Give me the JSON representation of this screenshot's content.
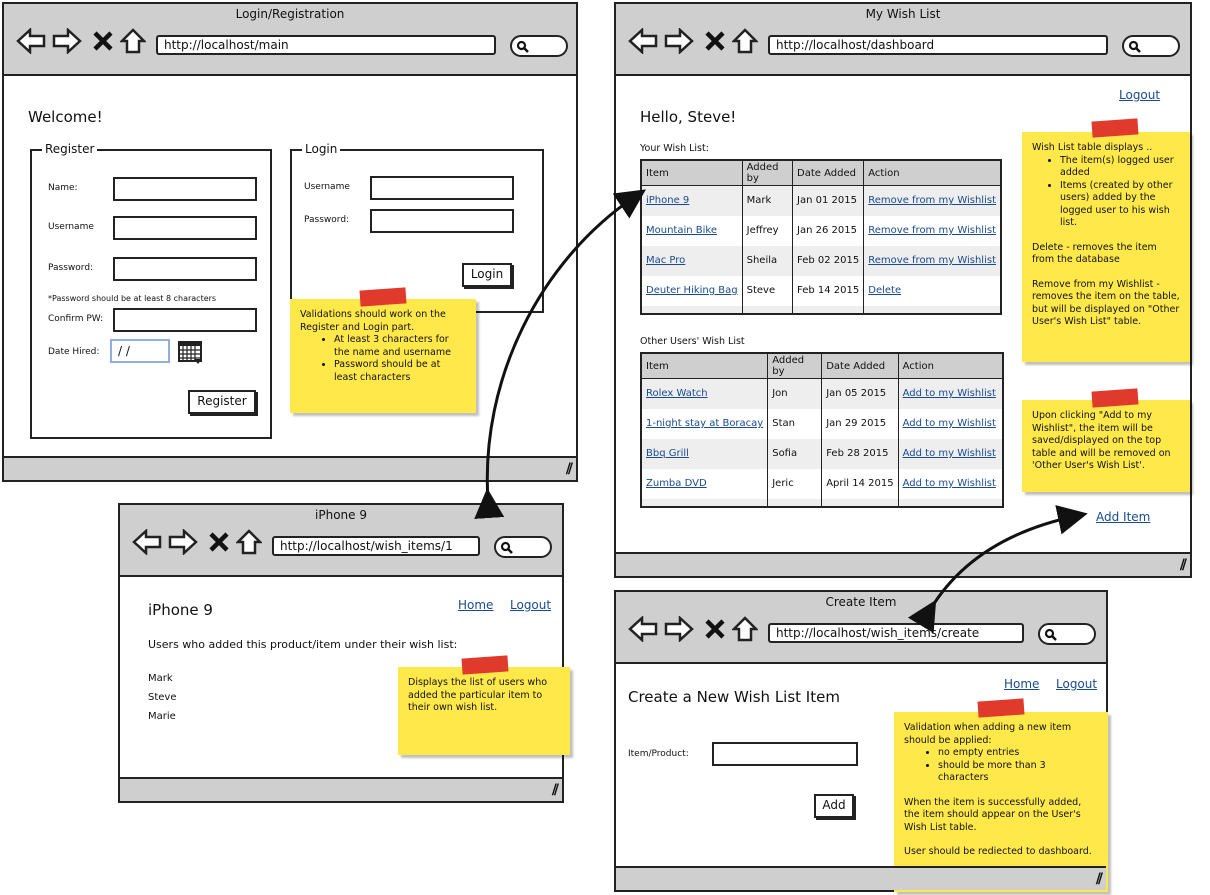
{
  "login_window": {
    "title": "Login/Registration",
    "url": "http://localhost/main",
    "welcome": "Welcome!",
    "register": {
      "legend": "Register",
      "name_label": "Name:",
      "username_label": "Username",
      "password_label": "Password:",
      "password_hint": "*Password should be at least 8 characters",
      "confirm_label": "Confirm PW:",
      "date_label": "Date Hired:",
      "date_value": " / /",
      "button": "Register"
    },
    "login": {
      "legend": "Login",
      "username_label": "Username",
      "password_label": "Password:",
      "button": "Login"
    },
    "note": {
      "intro": "Validations should work on the Register and Login part.",
      "items": [
        "At least 3 characters for the name and username",
        "Password should be at least characters"
      ]
    }
  },
  "wishlist_window": {
    "title": "My Wish List",
    "url": "http://localhost/dashboard",
    "logout": "Logout",
    "greeting": "Hello, Steve!",
    "your_list_label": "Your Wish List:",
    "other_list_label": "Other Users' Wish List",
    "columns": [
      "Item",
      "Added by",
      "Date Added",
      "Action"
    ],
    "your_rows": [
      {
        "item": "iPhone 9",
        "added_by": "Mark",
        "date": "Jan 01 2015",
        "action": "Remove from my Wishlist"
      },
      {
        "item": "Mountain Bike",
        "added_by": "Jeffrey",
        "date": "Jan 26 2015",
        "action": "Remove from my Wishlist"
      },
      {
        "item": "Mac Pro",
        "added_by": "Sheila",
        "date": "Feb 02 2015",
        "action": "Remove from my Wishlist"
      },
      {
        "item": "Deuter Hiking Bag",
        "added_by": "Steve",
        "date": "Feb 14 2015",
        "action": "Delete"
      }
    ],
    "other_rows": [
      {
        "item": "Rolex Watch",
        "added_by": "Jon",
        "date": "Jan 05 2015",
        "action": "Add to my Wishlist"
      },
      {
        "item": "1-night stay at Boracay",
        "added_by": "Stan",
        "date": "Jan 29 2015",
        "action": "Add to my Wishlist"
      },
      {
        "item": "Bbq Grill",
        "added_by": "Sofia",
        "date": "Feb 28 2015",
        "action": "Add to my Wishlist"
      },
      {
        "item": "Zumba DVD",
        "added_by": "Jeric",
        "date": "April 14 2015",
        "action": "Add to my Wishlist"
      }
    ],
    "add_item": "Add Item",
    "note1": {
      "intro": "Wish List table displays ..",
      "items": [
        "The item(s) logged user added",
        "Items (created by other users) added by the logged user to his wish list."
      ],
      "p1": "Delete - removes the item from the database",
      "p2": "Remove from my Wishlist - removes the item on the table, but will be displayed on \"Other User's Wish List\" table."
    },
    "note2": {
      "text": "Upon clicking \"Add to my Wishlist\", the item will be saved/displayed on the top table and will be removed on 'Other User's Wish List'."
    }
  },
  "item_window": {
    "title": "iPhone 9",
    "url": "http://localhost/wish_items/1",
    "heading": "iPhone 9",
    "home": "Home",
    "logout": "Logout",
    "subheading": "Users who added this product/item under their wish list:",
    "users": [
      "Mark",
      "Steve",
      "Marie"
    ],
    "note": {
      "text": "Displays the list of users who added the particular item to their own wish list."
    }
  },
  "create_window": {
    "title": "Create Item",
    "url": "http://localhost/wish_items/create",
    "heading": "Create a New Wish List Item",
    "home": "Home",
    "logout": "Logout",
    "field_label": "Item/Product:",
    "button": "Add",
    "note": {
      "intro": "Validation when adding a new item should be applied:",
      "items": [
        "no empty entries",
        "should be more than 3 characters"
      ],
      "p1": "When the item is successfully added, the item should appear on the User's Wish List table.",
      "p2": "User should be rediected to dashboard."
    }
  },
  "colors": {
    "chrome": "#cfcfcf",
    "note": "#ffe84a",
    "tape": "#e03a2c",
    "link": "#1a4a8f"
  }
}
